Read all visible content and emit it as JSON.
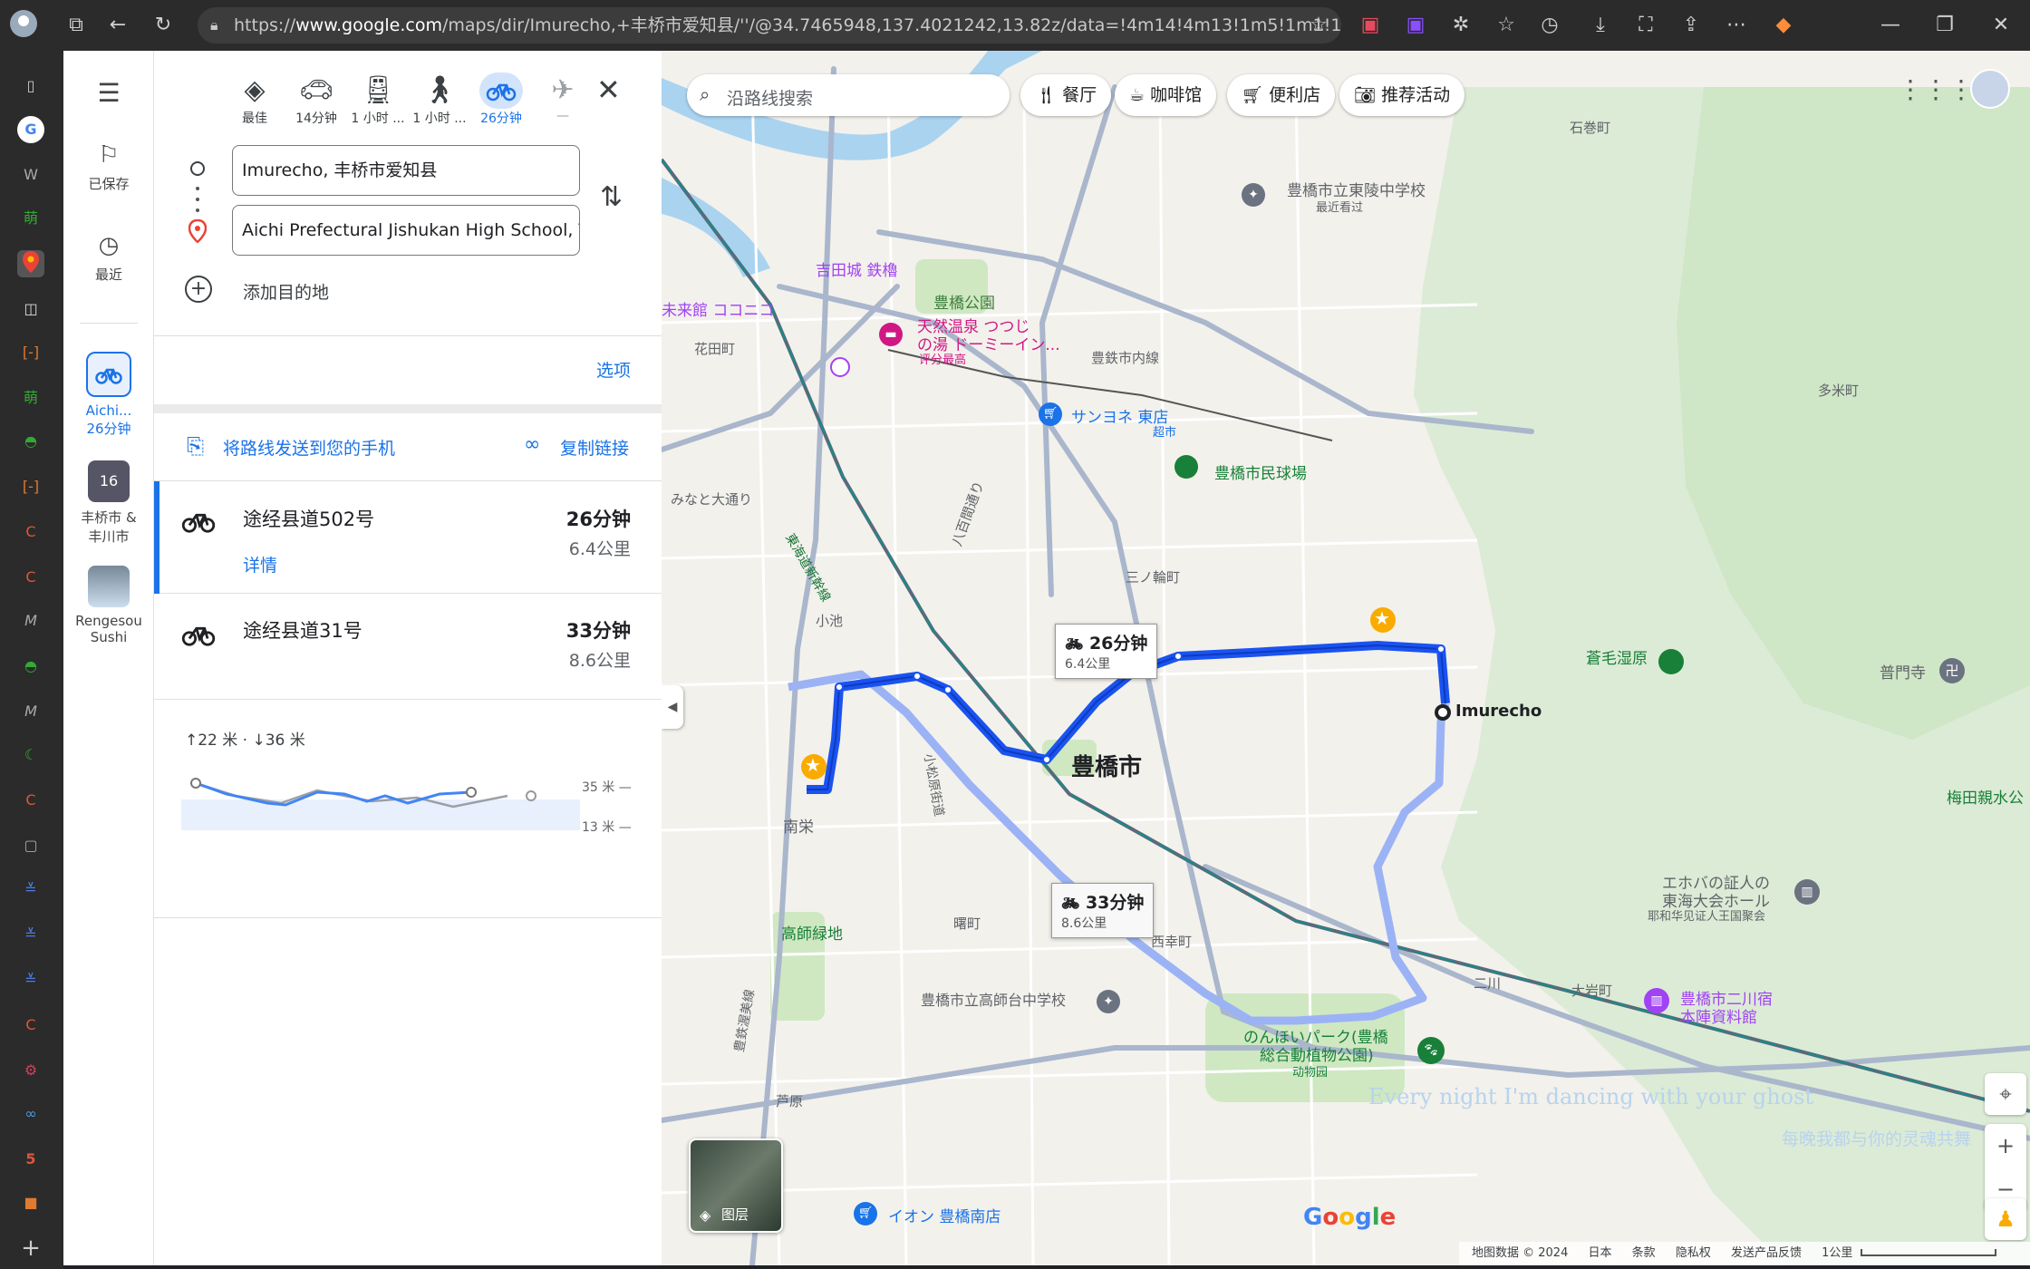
{
  "browser": {
    "url_prefix": "https://",
    "url_host": "www.google.com",
    "url_path": "/maps/dir/Imurecho,+丰桥市爱知县/''/@34.7465948,137.4021242,13.82z/data=!4m14!4m13!1m5!1m1!1s0x600..."
  },
  "rail": {
    "saved": "已保存",
    "recent": "最近",
    "recent_place_1_line1": "Aichi...",
    "recent_place_1_line2": "26分钟",
    "recent_place_2_line1": "丰桥市 &",
    "recent_place_2_line2": "丰川市",
    "recent_place_3_line1": "Rengesou",
    "recent_place_3_line2": "Sushi"
  },
  "modes": [
    {
      "label": "最佳"
    },
    {
      "label": "14分钟"
    },
    {
      "label": "1 小时 ..."
    },
    {
      "label": "1 小时 ..."
    },
    {
      "label": "26分钟"
    },
    {
      "label": "—"
    }
  ],
  "directions": {
    "origin": "Imurecho, 丰桥市爱知县",
    "destination": "Aichi Prefectural Jishukan High School, T",
    "add_destination": "添加目的地",
    "options": "选项",
    "send_to_phone": "将路线发送到您的手机",
    "copy_link": "复制链接"
  },
  "routes": [
    {
      "name": "途经县道502号",
      "time": "26分钟",
      "distance": "6.4公里",
      "details": "详情"
    },
    {
      "name": "途经县道31号",
      "time": "33分钟",
      "distance": "8.6公里"
    }
  ],
  "elevation": {
    "summary": "↑22 米 · ↓36 米",
    "max_label": "35 米 —",
    "min_label": "13 米 —"
  },
  "map": {
    "search_placeholder": "沿路线搜索",
    "chips": [
      "餐厅",
      "咖啡馆",
      "便利店",
      "推荐活动"
    ],
    "bubble1_time": "26分钟",
    "bubble1_dist": "6.4公里",
    "bubble2_time": "33分钟",
    "bubble2_dist": "8.6公里",
    "layers": "图层",
    "attribution": [
      "地图数据 © 2024",
      "日本",
      "条款",
      "隐私权",
      "发送产品反馈",
      "1公里"
    ],
    "labels": [
      {
        "t": "豊橋市",
        "c": "#202124"
      },
      {
        "t": "Imurecho",
        "c": "#202124"
      },
      {
        "t": "石巻町",
        "c": "#5f6368"
      },
      {
        "t": "豊橋市立東陵中学校",
        "c": "#5f6368"
      },
      {
        "t": "最近看过",
        "c": "#5f6368"
      },
      {
        "t": "吉田城 鉄櫓",
        "c": "#a142f4"
      },
      {
        "t": "豊橋公園",
        "c": "#3c7d3c"
      },
      {
        "t": "未来館 ココニコ",
        "c": "#a142f4"
      },
      {
        "t": "天然温泉 つつじ",
        "c": "#d01884"
      },
      {
        "t": "の湯 ドーミーイン...",
        "c": "#d01884"
      },
      {
        "t": "评分最高",
        "c": "#d01884"
      },
      {
        "t": "花田町",
        "c": "#5f6368"
      },
      {
        "t": "豊鉄市内線",
        "c": "#5f6368"
      },
      {
        "t": "多米町",
        "c": "#5f6368"
      },
      {
        "t": "サンヨネ 東店",
        "c": "#1a73e8"
      },
      {
        "t": "超市",
        "c": "#1a73e8"
      },
      {
        "t": "豊橋市民球場",
        "c": "#188038"
      },
      {
        "t": "みなと大通り",
        "c": "#5f6368"
      },
      {
        "t": "八百間通り",
        "c": "#5f6368"
      },
      {
        "t": "東海道新幹線",
        "c": "#137333"
      },
      {
        "t": "三ノ輪町",
        "c": "#5f6368"
      },
      {
        "t": "小池",
        "c": "#5f6368"
      },
      {
        "t": "蒼毛湿原",
        "c": "#188038"
      },
      {
        "t": "普門寺",
        "c": "#5f6368"
      },
      {
        "t": "南栄",
        "c": "#5f6368"
      },
      {
        "t": "小松原街道",
        "c": "#5f6368"
      },
      {
        "t": "梅田親水公",
        "c": "#188038"
      },
      {
        "t": "エホバの証人の",
        "c": "#5f6368"
      },
      {
        "t": "東海大会ホール",
        "c": "#5f6368"
      },
      {
        "t": "耶和华见证人王国聚会",
        "c": "#5f6368"
      },
      {
        "t": "高師緑地",
        "c": "#188038"
      },
      {
        "t": "曙町",
        "c": "#5f6368"
      },
      {
        "t": "西幸町",
        "c": "#5f6368"
      },
      {
        "t": "豊橋市立高師台中学校",
        "c": "#5f6368"
      },
      {
        "t": "二川",
        "c": "#5f6368"
      },
      {
        "t": "大岩町",
        "c": "#5f6368"
      },
      {
        "t": "豊橋市二川宿",
        "c": "#a142f4"
      },
      {
        "t": "本陣資料館",
        "c": "#a142f4"
      },
      {
        "t": "のんほいパーク(豊橋",
        "c": "#188038"
      },
      {
        "t": "総合動植物公園)",
        "c": "#188038"
      },
      {
        "t": "动物园",
        "c": "#188038"
      },
      {
        "t": "芦原",
        "c": "#5f6368"
      },
      {
        "t": "イオン 豊橋南店",
        "c": "#1a73e8"
      },
      {
        "t": "豊鉄渥美線",
        "c": "#5f6368"
      }
    ],
    "overlay_text_1": "Every night I'm dancing with your ghost",
    "overlay_text_2": "每晚我都与你的灵魂共舞"
  },
  "colors": {
    "accent": "#1a73e8",
    "route_primary": "#1a53f0",
    "route_alt": "#9bb3f5"
  }
}
